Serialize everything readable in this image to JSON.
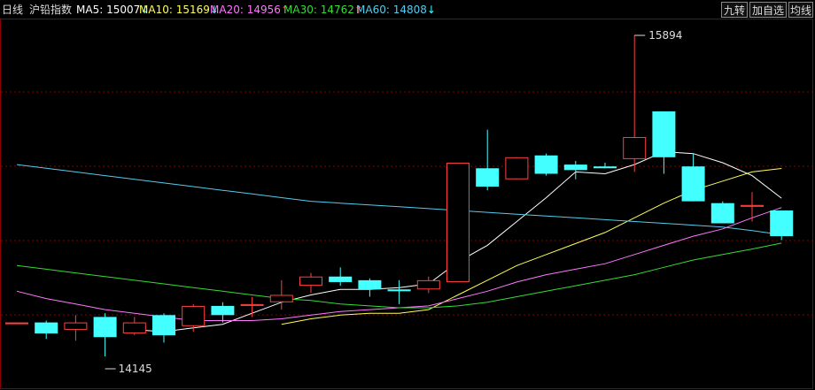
{
  "header": {
    "period": "日线",
    "instrument": "沪铅指数",
    "ma": [
      {
        "name": "MA5",
        "value": "15007",
        "arrow": "↓",
        "color": "#ffffff"
      },
      {
        "name": "MA10",
        "value": "15169",
        "arrow": "↓",
        "color": "#ffff55"
      },
      {
        "name": "MA20",
        "value": "14956",
        "arrow": "↑",
        "color": "#ff77ff"
      },
      {
        "name": "MA30",
        "value": "14762",
        "arrow": "↑",
        "color": "#33dd33"
      },
      {
        "name": "MA60",
        "value": "14808",
        "arrow": "↓",
        "color": "#55ccee"
      }
    ],
    "arrow_colors": {
      "up": "#ff4444",
      "down": "#33ffff"
    }
  },
  "toolbar": {
    "nine_turn": "九转",
    "add_watch": "加自选",
    "ma_line": "均线"
  },
  "chart_data": {
    "type": "candlestick",
    "annotations": {
      "high": "15894",
      "low": "14145"
    },
    "colors": {
      "up": "#ff4040",
      "down": "#44ffff",
      "grid": "#8b0000"
    },
    "candles": [
      {
        "o": 14330,
        "c": 14330,
        "h": 14330,
        "l": 14330
      },
      {
        "o": 14330,
        "c": 14270,
        "h": 14340,
        "l": 14240
      },
      {
        "o": 14290,
        "c": 14330,
        "h": 14370,
        "l": 14230
      },
      {
        "o": 14360,
        "c": 14250,
        "h": 14380,
        "l": 14145
      },
      {
        "o": 14270,
        "c": 14330,
        "h": 14360,
        "l": 14260
      },
      {
        "o": 14370,
        "c": 14260,
        "h": 14380,
        "l": 14220
      },
      {
        "o": 14310,
        "c": 14420,
        "h": 14430,
        "l": 14280
      },
      {
        "o": 14420,
        "c": 14370,
        "h": 14440,
        "l": 14330
      },
      {
        "o": 14420,
        "c": 14430,
        "h": 14470,
        "l": 14360
      },
      {
        "o": 14440,
        "c": 14480,
        "h": 14560,
        "l": 14400
      },
      {
        "o": 14530,
        "c": 14580,
        "h": 14600,
        "l": 14490
      },
      {
        "o": 14580,
        "c": 14550,
        "h": 14630,
        "l": 14530
      },
      {
        "o": 14560,
        "c": 14510,
        "h": 14570,
        "l": 14470
      },
      {
        "o": 14510,
        "c": 14500,
        "h": 14560,
        "l": 14430
      },
      {
        "o": 14510,
        "c": 14560,
        "h": 14580,
        "l": 14490
      },
      {
        "o": 14550,
        "c": 15200,
        "h": 15200,
        "l": 14550
      },
      {
        "o": 15170,
        "c": 15070,
        "h": 15380,
        "l": 15050
      },
      {
        "o": 15110,
        "c": 15230,
        "h": 15230,
        "l": 15110
      },
      {
        "o": 15240,
        "c": 15140,
        "h": 15250,
        "l": 15130
      },
      {
        "o": 15190,
        "c": 15160,
        "h": 15210,
        "l": 15110
      },
      {
        "o": 15180,
        "c": 15170,
        "h": 15200,
        "l": 15170
      },
      {
        "o": 15220,
        "c": 15340,
        "h": 15894,
        "l": 15150
      },
      {
        "o": 15480,
        "c": 15230,
        "h": 15480,
        "l": 15140
      },
      {
        "o": 15180,
        "c": 14990,
        "h": 15250,
        "l": 14990
      },
      {
        "o": 14980,
        "c": 14870,
        "h": 14990,
        "l": 14870
      },
      {
        "o": 14960,
        "c": 14970,
        "h": 15040,
        "l": 14880
      },
      {
        "o": 14940,
        "c": 14800,
        "h": 14940,
        "l": 14780
      }
    ],
    "ma_series": [
      {
        "name": "MA5",
        "color": "#ffffff",
        "values": [
          null,
          null,
          null,
          null,
          14290,
          14280,
          14300,
          14320,
          14380,
          14440,
          14480,
          14510,
          14510,
          14520,
          14540,
          14660,
          14750,
          14880,
          15010,
          15150,
          15140,
          15190,
          15260,
          15250,
          15200,
          15130,
          15007
        ]
      },
      {
        "name": "MA10",
        "color": "#ffff55",
        "values": [
          null,
          null,
          null,
          null,
          null,
          null,
          null,
          null,
          null,
          14320,
          14350,
          14370,
          14380,
          14380,
          14400,
          14480,
          14560,
          14640,
          14700,
          14760,
          14820,
          14900,
          14980,
          15050,
          15100,
          15150,
          15169
        ]
      },
      {
        "name": "MA20",
        "color": "#ff77ff",
        "values": [
          14500,
          14460,
          14430,
          14400,
          14380,
          14360,
          14340,
          14340,
          14340,
          14350,
          14370,
          14390,
          14400,
          14410,
          14420,
          14460,
          14500,
          14550,
          14590,
          14620,
          14650,
          14700,
          14750,
          14800,
          14840,
          14900,
          14956
        ]
      },
      {
        "name": "MA30",
        "color": "#33dd33",
        "values": [
          14640,
          14620,
          14600,
          14580,
          14560,
          14540,
          14520,
          14500,
          14480,
          14460,
          14450,
          14430,
          14420,
          14410,
          14410,
          14420,
          14440,
          14470,
          14500,
          14530,
          14560,
          14590,
          14630,
          14670,
          14700,
          14730,
          14762
        ]
      },
      {
        "name": "MA60",
        "color": "#55ccee",
        "values": [
          15190,
          15170,
          15150,
          15130,
          15110,
          15090,
          15070,
          15050,
          15030,
          15010,
          14990,
          14980,
          14970,
          14960,
          14950,
          14940,
          14930,
          14920,
          14910,
          14900,
          14890,
          14880,
          14870,
          14860,
          14850,
          14830,
          14808
        ]
      }
    ]
  }
}
